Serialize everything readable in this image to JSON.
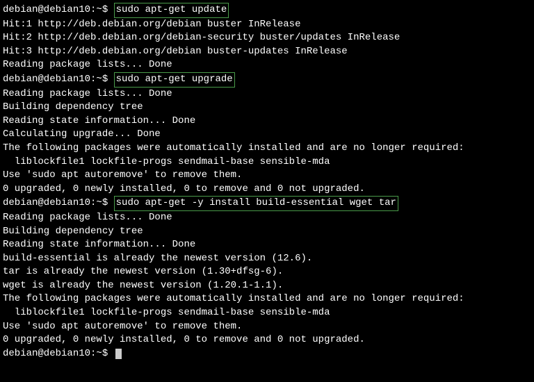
{
  "lines": [
    {
      "type": "prompt_cmd",
      "prompt": "debian@debian10:~$ ",
      "cmd": "sudo apt-get update",
      "boxed": true
    },
    {
      "type": "output",
      "text": "Hit:1 http://deb.debian.org/debian buster InRelease"
    },
    {
      "type": "output",
      "text": "Hit:2 http://deb.debian.org/debian-security buster/updates InRelease"
    },
    {
      "type": "output",
      "text": "Hit:3 http://deb.debian.org/debian buster-updates InRelease"
    },
    {
      "type": "output",
      "text": "Reading package lists... Done"
    },
    {
      "type": "prompt_cmd",
      "prompt": "debian@debian10:~$ ",
      "cmd": "sudo apt-get upgrade",
      "boxed": true
    },
    {
      "type": "output",
      "text": "Reading package lists... Done"
    },
    {
      "type": "output",
      "text": "Building dependency tree"
    },
    {
      "type": "output",
      "text": "Reading state information... Done"
    },
    {
      "type": "output",
      "text": "Calculating upgrade... Done"
    },
    {
      "type": "output",
      "text": "The following packages were automatically installed and are no longer required:"
    },
    {
      "type": "output",
      "text": "  liblockfile1 lockfile-progs sendmail-base sensible-mda"
    },
    {
      "type": "output",
      "text": "Use 'sudo apt autoremove' to remove them."
    },
    {
      "type": "output",
      "text": "0 upgraded, 0 newly installed, 0 to remove and 0 not upgraded."
    },
    {
      "type": "prompt_cmd",
      "prompt": "debian@debian10:~$ ",
      "cmd": "sudo apt-get -y install build-essential wget tar",
      "boxed": true
    },
    {
      "type": "output",
      "text": "Reading package lists... Done"
    },
    {
      "type": "output",
      "text": "Building dependency tree"
    },
    {
      "type": "output",
      "text": "Reading state information... Done"
    },
    {
      "type": "output",
      "text": "build-essential is already the newest version (12.6)."
    },
    {
      "type": "output",
      "text": "tar is already the newest version (1.30+dfsg-6)."
    },
    {
      "type": "output",
      "text": "wget is already the newest version (1.20.1-1.1)."
    },
    {
      "type": "output",
      "text": "The following packages were automatically installed and are no longer required:"
    },
    {
      "type": "output",
      "text": "  liblockfile1 lockfile-progs sendmail-base sensible-mda"
    },
    {
      "type": "output",
      "text": "Use 'sudo apt autoremove' to remove them."
    },
    {
      "type": "output",
      "text": "0 upgraded, 0 newly installed, 0 to remove and 0 not upgraded."
    },
    {
      "type": "prompt_cursor",
      "prompt": "debian@debian10:~$ "
    }
  ]
}
